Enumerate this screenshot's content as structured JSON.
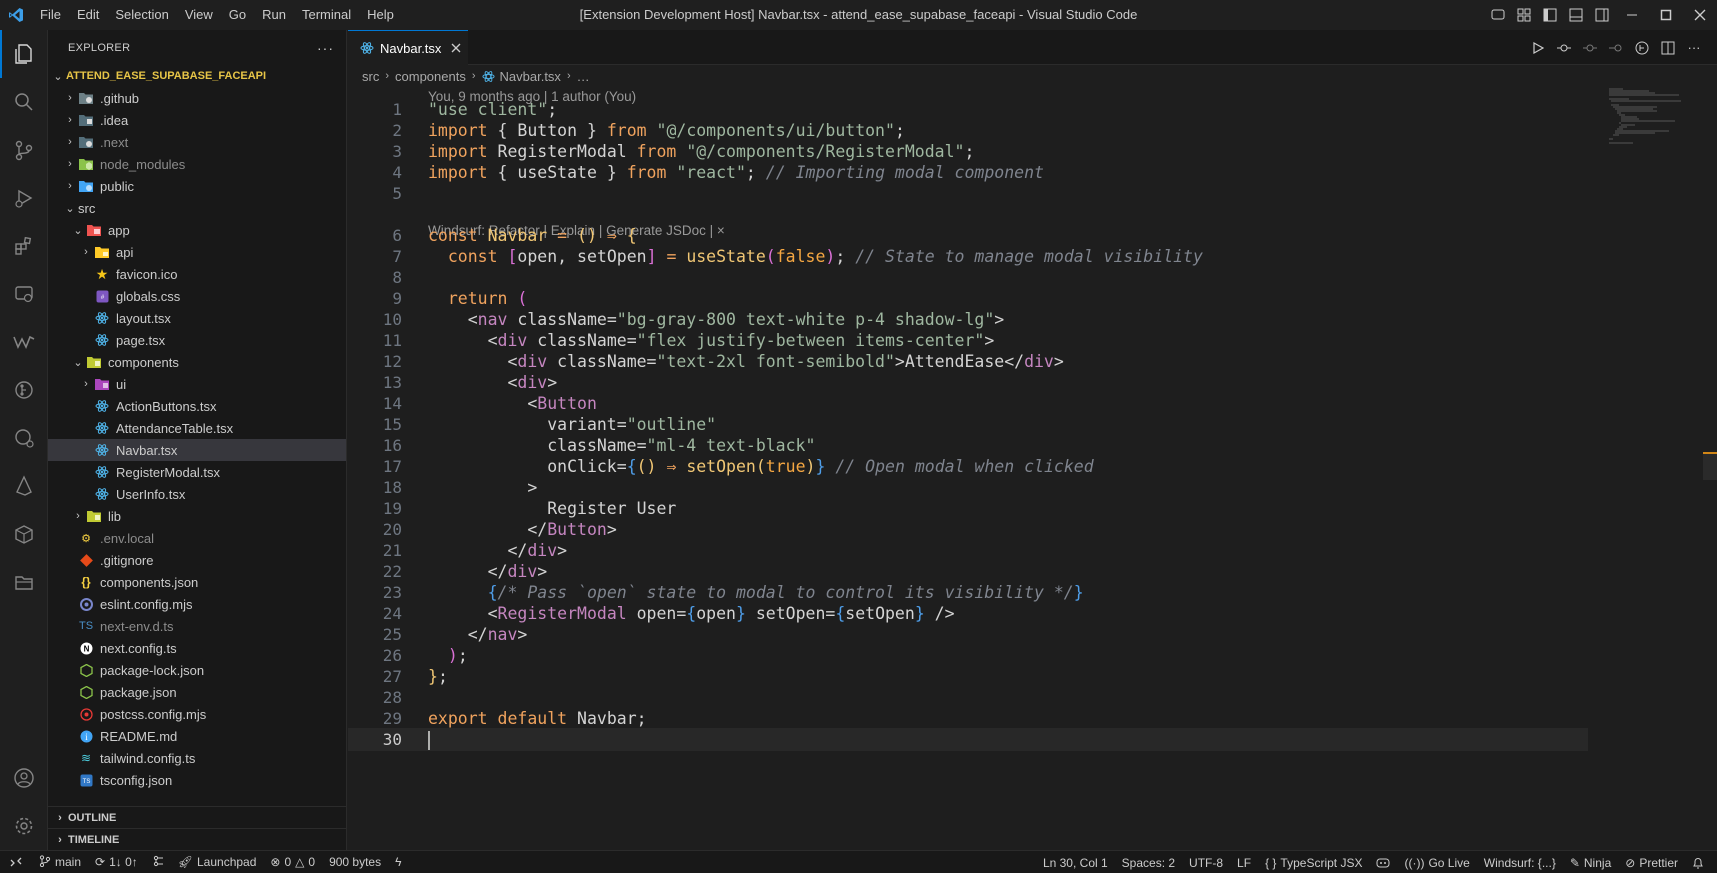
{
  "window": {
    "title": "[Extension Development Host] Navbar.tsx - attend_ease_supabase_faceapi - Visual Studio Code",
    "menu": [
      "File",
      "Edit",
      "Selection",
      "View",
      "Go",
      "Run",
      "Terminal",
      "Help"
    ]
  },
  "sidebar": {
    "header": "EXPLORER",
    "root": "ATTEND_EASE_SUPABASE_FACEAPI",
    "tree": [
      {
        "label": ".github",
        "indent": 0,
        "type": "folder",
        "open": false,
        "icon": "github-folder-icon",
        "color": "#cccccc"
      },
      {
        "label": ".idea",
        "indent": 0,
        "type": "folder",
        "open": false,
        "icon": "idea-folder-icon",
        "color": "#cccccc"
      },
      {
        "label": ".next",
        "indent": 0,
        "type": "folder",
        "open": false,
        "icon": "next-folder-icon",
        "color": "#8c8c8c"
      },
      {
        "label": "node_modules",
        "indent": 0,
        "type": "folder",
        "open": false,
        "icon": "node-folder-icon",
        "color": "#8c8c8c"
      },
      {
        "label": "public",
        "indent": 0,
        "type": "folder",
        "open": false,
        "icon": "public-folder-icon",
        "color": "#cccccc"
      },
      {
        "label": "src",
        "indent": 0,
        "type": "folder",
        "open": true,
        "icon": "none",
        "color": "#cccccc"
      },
      {
        "label": "app",
        "indent": 1,
        "type": "folder",
        "open": true,
        "icon": "app-folder-icon",
        "color": "#cccccc"
      },
      {
        "label": "api",
        "indent": 2,
        "type": "folder",
        "open": false,
        "icon": "api-folder-icon",
        "color": "#cccccc"
      },
      {
        "label": "favicon.ico",
        "indent": 2,
        "type": "file",
        "icon": "star-icon",
        "color": "#cccccc"
      },
      {
        "label": "globals.css",
        "indent": 2,
        "type": "file",
        "icon": "css-icon",
        "color": "#cccccc"
      },
      {
        "label": "layout.tsx",
        "indent": 2,
        "type": "file",
        "icon": "react-icon",
        "color": "#cccccc"
      },
      {
        "label": "page.tsx",
        "indent": 2,
        "type": "file",
        "icon": "react-icon",
        "color": "#cccccc"
      },
      {
        "label": "components",
        "indent": 1,
        "type": "folder",
        "open": true,
        "icon": "components-folder-icon",
        "color": "#cccccc"
      },
      {
        "label": "ui",
        "indent": 2,
        "type": "folder",
        "open": false,
        "icon": "ui-folder-icon",
        "color": "#cccccc"
      },
      {
        "label": "ActionButtons.tsx",
        "indent": 2,
        "type": "file",
        "icon": "react-icon",
        "color": "#cccccc"
      },
      {
        "label": "AttendanceTable.tsx",
        "indent": 2,
        "type": "file",
        "icon": "react-icon",
        "color": "#cccccc"
      },
      {
        "label": "Navbar.tsx",
        "indent": 2,
        "type": "file",
        "icon": "react-icon",
        "color": "#cccccc",
        "selected": true
      },
      {
        "label": "RegisterModal.tsx",
        "indent": 2,
        "type": "file",
        "icon": "react-icon",
        "color": "#cccccc"
      },
      {
        "label": "UserInfo.tsx",
        "indent": 2,
        "type": "file",
        "icon": "react-icon",
        "color": "#cccccc"
      },
      {
        "label": "lib",
        "indent": 1,
        "type": "folder",
        "open": false,
        "icon": "lib-folder-icon",
        "color": "#cccccc"
      },
      {
        "label": ".env.local",
        "indent": 0,
        "type": "file",
        "icon": "env-icon",
        "color": "#8c8c8c"
      },
      {
        "label": ".gitignore",
        "indent": 0,
        "type": "file",
        "icon": "git-icon",
        "color": "#cccccc"
      },
      {
        "label": "components.json",
        "indent": 0,
        "type": "file",
        "icon": "json-icon",
        "color": "#cccccc"
      },
      {
        "label": "eslint.config.mjs",
        "indent": 0,
        "type": "file",
        "icon": "eslint-icon",
        "color": "#cccccc"
      },
      {
        "label": "next-env.d.ts",
        "indent": 0,
        "type": "file",
        "icon": "ts-def-icon",
        "color": "#8c8c8c"
      },
      {
        "label": "next.config.ts",
        "indent": 0,
        "type": "file",
        "icon": "next-icon",
        "color": "#cccccc"
      },
      {
        "label": "package-lock.json",
        "indent": 0,
        "type": "file",
        "icon": "npm-icon",
        "color": "#cccccc"
      },
      {
        "label": "package.json",
        "indent": 0,
        "type": "file",
        "icon": "npm-icon",
        "color": "#cccccc"
      },
      {
        "label": "postcss.config.mjs",
        "indent": 0,
        "type": "file",
        "icon": "postcss-icon",
        "color": "#cccccc"
      },
      {
        "label": "README.md",
        "indent": 0,
        "type": "file",
        "icon": "readme-icon",
        "color": "#cccccc"
      },
      {
        "label": "tailwind.config.ts",
        "indent": 0,
        "type": "file",
        "icon": "tailwind-icon",
        "color": "#cccccc"
      },
      {
        "label": "tsconfig.json",
        "indent": 0,
        "type": "file",
        "icon": "tsconfig-icon",
        "color": "#cccccc"
      }
    ],
    "outline": "OUTLINE",
    "timeline": "TIMELINE"
  },
  "editor": {
    "tab_label": "Navbar.tsx",
    "breadcrumb": [
      "src",
      "components",
      "Navbar.tsx",
      "…"
    ],
    "blame": "You, 9 months ago | 1 author (You)",
    "codelens": "Windsurf: Refactor | Explain | Generate JSDoc | ×",
    "lines": [
      {
        "n": "1",
        "tokens": [
          [
            "s",
            "\"use client\""
          ],
          [
            "v",
            ";"
          ]
        ]
      },
      {
        "n": "2",
        "tokens": [
          [
            "k",
            "import"
          ],
          [
            "v",
            " { Button } "
          ],
          [
            "k",
            "from"
          ],
          [
            "v",
            " "
          ],
          [
            "s",
            "\"@/components/ui/button\""
          ],
          [
            "v",
            ";"
          ]
        ]
      },
      {
        "n": "3",
        "tokens": [
          [
            "k",
            "import"
          ],
          [
            "v",
            " RegisterModal "
          ],
          [
            "k",
            "from"
          ],
          [
            "v",
            " "
          ],
          [
            "s",
            "\"@/components/RegisterModal\""
          ],
          [
            "v",
            ";"
          ]
        ]
      },
      {
        "n": "4",
        "tokens": [
          [
            "k",
            "import"
          ],
          [
            "v",
            " { useState } "
          ],
          [
            "k",
            "from"
          ],
          [
            "v",
            " "
          ],
          [
            "s",
            "\"react\""
          ],
          [
            "v",
            "; "
          ],
          [
            "c",
            "// Importing modal component"
          ]
        ]
      },
      {
        "n": "5",
        "tokens": []
      },
      {
        "n": "6",
        "tokens": [
          [
            "k",
            "const"
          ],
          [
            "f",
            " Navbar"
          ],
          [
            "v",
            " "
          ],
          [
            "k",
            "="
          ],
          [
            "v",
            " "
          ],
          [
            "p1",
            "()"
          ],
          [
            "v",
            " "
          ],
          [
            "k",
            "⇒"
          ],
          [
            "v",
            " "
          ],
          [
            "p1",
            "{"
          ]
        ]
      },
      {
        "n": "7",
        "tokens": [
          [
            "v",
            "  "
          ],
          [
            "k",
            "const"
          ],
          [
            "v",
            " "
          ],
          [
            "p2",
            "["
          ],
          [
            "v",
            "open, setOpen"
          ],
          [
            "p2",
            "]"
          ],
          [
            "v",
            " "
          ],
          [
            "k",
            "="
          ],
          [
            "v",
            " "
          ],
          [
            "f",
            "useState"
          ],
          [
            "p2",
            "("
          ],
          [
            "cst",
            "false"
          ],
          [
            "p2",
            ")"
          ],
          [
            "v",
            "; "
          ],
          [
            "c",
            "// State to manage modal visibility"
          ]
        ]
      },
      {
        "n": "8",
        "tokens": []
      },
      {
        "n": "9",
        "tokens": [
          [
            "v",
            "  "
          ],
          [
            "k",
            "return"
          ],
          [
            "v",
            " "
          ],
          [
            "p2",
            "("
          ]
        ]
      },
      {
        "n": "10",
        "tokens": [
          [
            "v",
            "    <"
          ],
          [
            "t",
            "nav"
          ],
          [
            "v",
            " className="
          ],
          [
            "s",
            "\"bg-gray-800 text-white p-4 shadow-lg\""
          ],
          [
            "v",
            ">"
          ]
        ]
      },
      {
        "n": "11",
        "tokens": [
          [
            "v",
            "      <"
          ],
          [
            "t",
            "div"
          ],
          [
            "v",
            " className="
          ],
          [
            "s",
            "\"flex justify-between items-center\""
          ],
          [
            "v",
            ">"
          ]
        ]
      },
      {
        "n": "12",
        "tokens": [
          [
            "v",
            "        <"
          ],
          [
            "t",
            "div"
          ],
          [
            "v",
            " className="
          ],
          [
            "s",
            "\"text-2xl font-semibold\""
          ],
          [
            "v",
            ">AttendEase</"
          ],
          [
            "t",
            "div"
          ],
          [
            "v",
            ">"
          ]
        ]
      },
      {
        "n": "13",
        "tokens": [
          [
            "v",
            "        <"
          ],
          [
            "t",
            "div"
          ],
          [
            "v",
            ">"
          ]
        ]
      },
      {
        "n": "14",
        "tokens": [
          [
            "v",
            "          <"
          ],
          [
            "t",
            "Button"
          ]
        ]
      },
      {
        "n": "15",
        "tokens": [
          [
            "v",
            "            variant="
          ],
          [
            "s",
            "\"outline\""
          ]
        ]
      },
      {
        "n": "16",
        "tokens": [
          [
            "v",
            "            className="
          ],
          [
            "s",
            "\"ml-4 text-black\""
          ]
        ]
      },
      {
        "n": "17",
        "tokens": [
          [
            "v",
            "            onClick="
          ],
          [
            "p3",
            "{"
          ],
          [
            "p1",
            "()"
          ],
          [
            "v",
            " "
          ],
          [
            "k",
            "⇒"
          ],
          [
            "v",
            " "
          ],
          [
            "f",
            "setOpen"
          ],
          [
            "p1",
            "("
          ],
          [
            "cst",
            "true"
          ],
          [
            "p1",
            ")"
          ],
          [
            "p3",
            "}"
          ],
          [
            "v",
            " "
          ],
          [
            "c",
            "// Open modal when clicked"
          ]
        ]
      },
      {
        "n": "18",
        "tokens": [
          [
            "v",
            "          >"
          ]
        ]
      },
      {
        "n": "19",
        "tokens": [
          [
            "v",
            "            Register User"
          ]
        ]
      },
      {
        "n": "20",
        "tokens": [
          [
            "v",
            "          </"
          ],
          [
            "t",
            "Button"
          ],
          [
            "v",
            ">"
          ]
        ]
      },
      {
        "n": "21",
        "tokens": [
          [
            "v",
            "        </"
          ],
          [
            "t",
            "div"
          ],
          [
            "v",
            ">"
          ]
        ]
      },
      {
        "n": "22",
        "tokens": [
          [
            "v",
            "      </"
          ],
          [
            "t",
            "div"
          ],
          [
            "v",
            ">"
          ]
        ]
      },
      {
        "n": "23",
        "tokens": [
          [
            "v",
            "      "
          ],
          [
            "p3",
            "{"
          ],
          [
            "c",
            "/* Pass `open` state to modal to control its visibility */"
          ],
          [
            "p3",
            "}"
          ]
        ]
      },
      {
        "n": "24",
        "tokens": [
          [
            "v",
            "      <"
          ],
          [
            "t",
            "RegisterModal"
          ],
          [
            "v",
            " open="
          ],
          [
            "p3",
            "{"
          ],
          [
            "v",
            "open"
          ],
          [
            "p3",
            "}"
          ],
          [
            "v",
            " setOpen="
          ],
          [
            "p3",
            "{"
          ],
          [
            "v",
            "setOpen"
          ],
          [
            "p3",
            "}"
          ],
          [
            "v",
            " />"
          ]
        ]
      },
      {
        "n": "25",
        "tokens": [
          [
            "v",
            "    </"
          ],
          [
            "t",
            "nav"
          ],
          [
            "v",
            ">"
          ]
        ]
      },
      {
        "n": "26",
        "tokens": [
          [
            "v",
            "  "
          ],
          [
            "p2",
            ")"
          ],
          [
            "v",
            ";"
          ]
        ]
      },
      {
        "n": "27",
        "tokens": [
          [
            "p1",
            "}"
          ],
          [
            "v",
            ";"
          ]
        ]
      },
      {
        "n": "28",
        "tokens": []
      },
      {
        "n": "29",
        "tokens": [
          [
            "k",
            "export"
          ],
          [
            "v",
            " "
          ],
          [
            "k",
            "default"
          ],
          [
            "v",
            " Navbar;"
          ]
        ]
      },
      {
        "n": "30",
        "tokens": [],
        "current": true
      }
    ]
  },
  "statusbar": {
    "branch": "main",
    "sync": "1↓ 0↑",
    "launchpad": "Launchpad",
    "errors": "0",
    "warnings": "0",
    "size": "900 bytes",
    "position": "Ln 30, Col 1",
    "spaces": "Spaces: 2",
    "encoding": "UTF-8",
    "eol": "LF",
    "language": "TypeScript JSX",
    "golive": "Go Live",
    "windsurf": "Windsurf: {...}",
    "ninja": "Ninja",
    "prettier": "Prettier"
  },
  "colors": {
    "accent": "#0078d4",
    "root_folder": "#e7c547",
    "react": "#4fb3e8"
  }
}
